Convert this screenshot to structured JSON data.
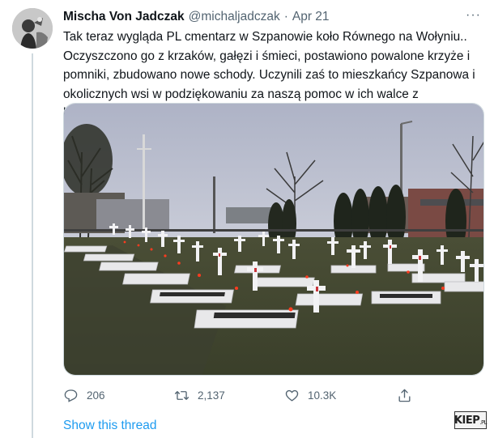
{
  "tweet": {
    "display_name": "Mischa Von Jadczak",
    "handle": "@michaljadczak",
    "separator": "·",
    "date": "Apr 21",
    "more_label": "···",
    "text": "Tak teraz wygląda PL cmentarz w Szpanowie koło Równego na Wołyniu.. Oczyszczono go z krzaków, gałęzi i śmieci, postawiono powalone krzyże i pomniki, zbudowano nowe schody. Uczynili zaś to mieszkańcy Szpanowa i okolicznych wsi w podziękowaniu za naszą pomoc w ich walce z kacapami.",
    "media_description": "cemetery-with-white-crosses-and-candles"
  },
  "actions": {
    "reply_count": "206",
    "retweet_count": "2,137",
    "like_count": "10.3K",
    "reply_icon": "reply-icon",
    "retweet_icon": "retweet-icon",
    "like_icon": "heart-icon",
    "share_icon": "share-icon"
  },
  "show_thread_label": "Show this thread",
  "watermark": {
    "main": "KIEP",
    "suffix": ".PL"
  },
  "colors": {
    "link": "#1d9bf0",
    "secondary_text": "#536471",
    "primary_text": "#0f1419",
    "thread_line": "#cfd9de"
  }
}
